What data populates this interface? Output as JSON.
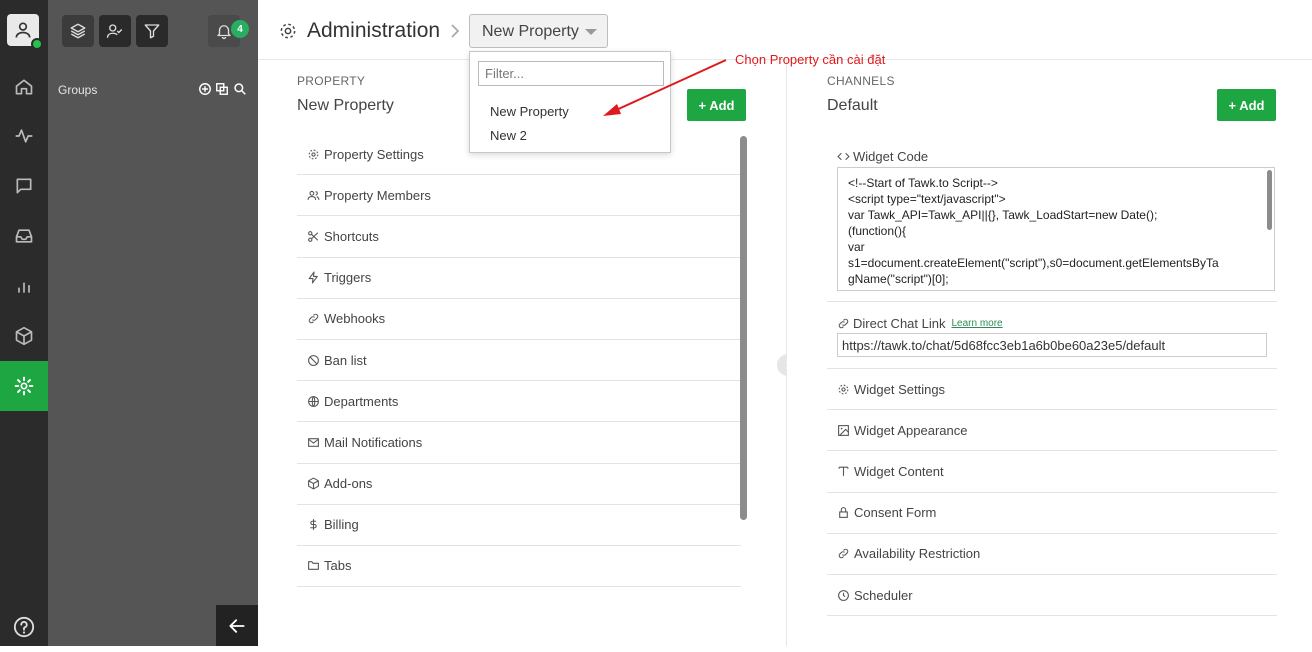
{
  "header": {
    "title": "Administration",
    "property_select_value": "New Property"
  },
  "sidebar": {
    "notification_count": "4",
    "groups_label": "Groups"
  },
  "property": {
    "section_label": "PROPERTY",
    "name": "New Property",
    "add_label": "+ Add",
    "menu": [
      {
        "label": "Property Settings",
        "icon": "gear-icon"
      },
      {
        "label": "Property Members",
        "icon": "users-icon"
      },
      {
        "label": "Shortcuts",
        "icon": "scissors-icon"
      },
      {
        "label": "Triggers",
        "icon": "bolt-icon"
      },
      {
        "label": "Webhooks",
        "icon": "link-icon"
      },
      {
        "label": "Ban list",
        "icon": "ban-icon"
      },
      {
        "label": "Departments",
        "icon": "globe-icon"
      },
      {
        "label": "Mail Notifications",
        "icon": "mail-icon"
      },
      {
        "label": "Add-ons",
        "icon": "box-icon"
      },
      {
        "label": "Billing",
        "icon": "dollar-icon"
      },
      {
        "label": "Tabs",
        "icon": "folder-icon"
      }
    ]
  },
  "channels": {
    "section_label": "CHANNELS",
    "name": "Default",
    "add_label": "+ Add",
    "widget_code_label": "Widget Code",
    "widget_code_lines": [
      "<!--Start of Tawk.to Script-->",
      "<script type=\"text/javascript\">",
      "var Tawk_API=Tawk_API||{}, Tawk_LoadStart=new Date();",
      "(function(){",
      "var",
      "s1=document.createElement(\"script\"),s0=document.getElementsByTa",
      "gName(\"script\")[0];"
    ],
    "direct_chat_label": "Direct Chat Link",
    "learn_more": "Learn more",
    "direct_chat_url": "https://tawk.to/chat/5d68fcc3eb1a6b0be60a23e5/default",
    "menu": [
      {
        "label": "Widget Settings",
        "icon": "gear-icon"
      },
      {
        "label": "Widget Appearance",
        "icon": "image-icon"
      },
      {
        "label": "Widget Content",
        "icon": "text-icon"
      },
      {
        "label": "Consent Form",
        "icon": "lock-icon"
      },
      {
        "label": "Availability Restriction",
        "icon": "link-icon"
      },
      {
        "label": "Scheduler",
        "icon": "clock-icon"
      }
    ]
  },
  "dropdown": {
    "filter_placeholder": "Filter...",
    "options": [
      "New Property",
      "New 2"
    ]
  },
  "annotation": {
    "text": "Chọn Property cần cài đặt",
    "color": "#e0191d"
  },
  "colors": {
    "accent": "#1ea642",
    "rail_bg": "#2b2b2b",
    "sidebar_bg": "#555555"
  }
}
